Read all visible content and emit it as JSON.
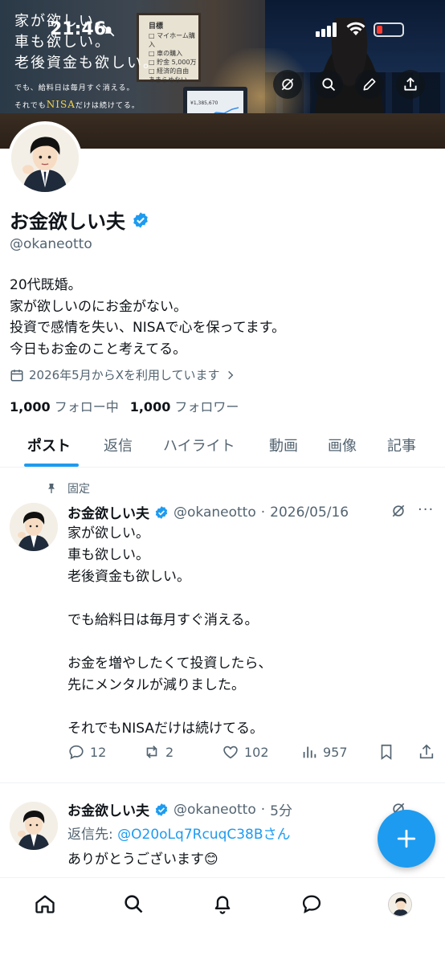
{
  "status_bar": {
    "time": "21:46"
  },
  "banner": {
    "lines": [
      "家が欲しい。",
      "車も欲しい。",
      "老後資金も欲しい。"
    ],
    "small1": "でも、給料日は毎月すぐ消える。",
    "small2_prefix": "それでも",
    "small2_nisa": "NISA",
    "small2_suffix": "だけは続けてる。",
    "board_title": "目標",
    "board_lines": [
      "□ マイホーム購入",
      "□ 車の購入",
      "□ 貯金 5,000万",
      "□ 経済的自由",
      "あきらめない"
    ],
    "laptop_amount": "¥1,385,670"
  },
  "profile": {
    "name": "お金欲しい夫",
    "handle": "@okaneotto",
    "bio": "20代既婚。\n家が欲しいのにお金がない。\n投資で感情を失い、NISAで心を保ってます。\n今日もお金のこと考えてる。",
    "joined": "2026年5月からXを利用しています",
    "following_count": "1,000",
    "following_label": "フォロー中",
    "followers_count": "1,000",
    "followers_label": "フォロワー"
  },
  "tabs": [
    "ポスト",
    "返信",
    "ハイライト",
    "動画",
    "画像",
    "記事"
  ],
  "posts": [
    {
      "pinned_label": "固定",
      "name": "お金欲しい夫",
      "handle": "@okaneotto",
      "sep": "·",
      "time": "2026/05/16",
      "body": "家が欲しい。\n車も欲しい。\n老後資金も欲しい。\n\nでも給料日は毎月すぐ消える。\n\nお金を増やしたくて投資したら、\n先にメンタルが減りました。\n\nそれでもNISAだけは続けてる。",
      "replies": "12",
      "reposts": "2",
      "likes": "102",
      "views": "957",
      "more": "···"
    },
    {
      "name": "お金欲しい夫",
      "handle": "@okaneotto",
      "sep": "·",
      "time": "5分",
      "reply_label": "返信先: ",
      "reply_to": "@O20oLq7RcuqC38Bさん",
      "body": "ありがとうございます😊"
    }
  ],
  "colors": {
    "accent": "#1d9bf0",
    "text": "#0f1419",
    "muted": "#536471"
  }
}
